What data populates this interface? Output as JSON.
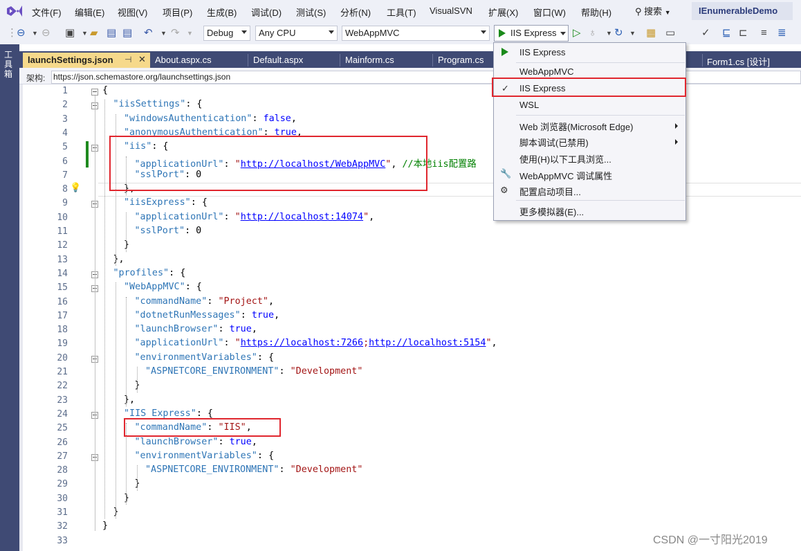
{
  "menubar": {
    "items": [
      "文件(F)",
      "编辑(E)",
      "视图(V)",
      "项目(P)",
      "生成(B)",
      "调试(D)",
      "测试(S)",
      "分析(N)",
      "工具(T)",
      "VisualSVN",
      "扩展(X)",
      "窗口(W)",
      "帮助(H)"
    ],
    "search_label": "搜索",
    "solution_name": "IEnumerableDemo"
  },
  "toolbar": {
    "configuration": "Debug",
    "platform": "Any CPU",
    "startup_project": "WebAppMVC",
    "run_target": "IIS Express"
  },
  "toolbox": {
    "label": "工具箱"
  },
  "tabs": [
    "launchSettings.json",
    "About.aspx.cs",
    "Default.aspx",
    "Mainform.cs",
    "Program.cs",
    "Form1.cs [设计]"
  ],
  "schema": {
    "label": "架构:",
    "value": "https://json.schemastore.org/launchsettings.json"
  },
  "editor": {
    "line_numbers": [
      "1",
      "2",
      "3",
      "4",
      "5",
      "6",
      "7",
      "8",
      "9",
      "10",
      "11",
      "12",
      "13",
      "14",
      "15",
      "16",
      "17",
      "18",
      "19",
      "20",
      "21",
      "22",
      "23",
      "24",
      "25",
      "26",
      "27",
      "28",
      "29",
      "30",
      "31",
      "32",
      "33"
    ],
    "lines": [
      {
        "parts": [
          {
            "t": "{",
            "c": "brace"
          }
        ]
      },
      {
        "parts": [
          {
            "t": "\"iisSettings\"",
            "c": "k"
          },
          {
            "t": ": {",
            "c": "brace"
          }
        ]
      },
      {
        "parts": [
          {
            "t": "\"windowsAuthentication\"",
            "c": "k"
          },
          {
            "t": ": ",
            "c": "brace"
          },
          {
            "t": "false",
            "c": "kw"
          },
          {
            "t": ",",
            "c": "brace"
          }
        ]
      },
      {
        "parts": [
          {
            "t": "\"anonymousAuthentication\"",
            "c": "k"
          },
          {
            "t": ": ",
            "c": "brace"
          },
          {
            "t": "true",
            "c": "kw"
          },
          {
            "t": ",",
            "c": "brace"
          }
        ]
      },
      {
        "parts": [
          {
            "t": "\"iis\"",
            "c": "k"
          },
          {
            "t": ": {",
            "c": "brace"
          }
        ]
      },
      {
        "parts": [
          {
            "t": "\"applicationUrl\"",
            "c": "k"
          },
          {
            "t": ": ",
            "c": "brace"
          },
          {
            "t": "\"",
            "c": "str"
          },
          {
            "t": "http://localhost/WebAppMVC",
            "c": "url"
          },
          {
            "t": "\"",
            "c": "str"
          },
          {
            "t": ", ",
            "c": "brace"
          },
          {
            "t": "//本地iis配置路",
            "c": "comment"
          }
        ]
      },
      {
        "parts": [
          {
            "t": "\"sslPort\"",
            "c": "k"
          },
          {
            "t": ": 0",
            "c": "brace"
          }
        ]
      },
      {
        "parts": [
          {
            "t": "},",
            "c": "brace"
          }
        ]
      },
      {
        "parts": [
          {
            "t": "\"iisExpress\"",
            "c": "k"
          },
          {
            "t": ": {",
            "c": "brace"
          }
        ]
      },
      {
        "parts": [
          {
            "t": "\"applicationUrl\"",
            "c": "k"
          },
          {
            "t": ": ",
            "c": "brace"
          },
          {
            "t": "\"",
            "c": "str"
          },
          {
            "t": "http://localhost:14074",
            "c": "url"
          },
          {
            "t": "\"",
            "c": "str"
          },
          {
            "t": ",",
            "c": "brace"
          }
        ]
      },
      {
        "parts": [
          {
            "t": "\"sslPort\"",
            "c": "k"
          },
          {
            "t": ": 0",
            "c": "brace"
          }
        ]
      },
      {
        "parts": [
          {
            "t": "}",
            "c": "brace"
          }
        ]
      },
      {
        "parts": [
          {
            "t": "},",
            "c": "brace"
          }
        ]
      },
      {
        "parts": [
          {
            "t": "\"profiles\"",
            "c": "k"
          },
          {
            "t": ": {",
            "c": "brace"
          }
        ]
      },
      {
        "parts": [
          {
            "t": "\"WebAppMVC\"",
            "c": "k"
          },
          {
            "t": ": {",
            "c": "brace"
          }
        ]
      },
      {
        "parts": [
          {
            "t": "\"commandName\"",
            "c": "k"
          },
          {
            "t": ": ",
            "c": "brace"
          },
          {
            "t": "\"Project\"",
            "c": "str"
          },
          {
            "t": ",",
            "c": "brace"
          }
        ]
      },
      {
        "parts": [
          {
            "t": "\"dotnetRunMessages\"",
            "c": "k"
          },
          {
            "t": ": ",
            "c": "brace"
          },
          {
            "t": "true",
            "c": "kw"
          },
          {
            "t": ",",
            "c": "brace"
          }
        ]
      },
      {
        "parts": [
          {
            "t": "\"launchBrowser\"",
            "c": "k"
          },
          {
            "t": ": ",
            "c": "brace"
          },
          {
            "t": "true",
            "c": "kw"
          },
          {
            "t": ",",
            "c": "brace"
          }
        ]
      },
      {
        "parts": [
          {
            "t": "\"applicationUrl\"",
            "c": "k"
          },
          {
            "t": ": ",
            "c": "brace"
          },
          {
            "t": "\"",
            "c": "str"
          },
          {
            "t": "https://localhost:7266",
            "c": "url"
          },
          {
            "t": ";",
            "c": "str"
          },
          {
            "t": "http://localhost:5154",
            "c": "url"
          },
          {
            "t": "\"",
            "c": "str"
          },
          {
            "t": ",",
            "c": "brace"
          }
        ]
      },
      {
        "parts": [
          {
            "t": "\"environmentVariables\"",
            "c": "k"
          },
          {
            "t": ": {",
            "c": "brace"
          }
        ]
      },
      {
        "parts": [
          {
            "t": "\"ASPNETCORE_ENVIRONMENT\"",
            "c": "k"
          },
          {
            "t": ": ",
            "c": "brace"
          },
          {
            "t": "\"Development\"",
            "c": "str"
          }
        ]
      },
      {
        "parts": [
          {
            "t": "}",
            "c": "brace"
          }
        ]
      },
      {
        "parts": [
          {
            "t": "},",
            "c": "brace"
          }
        ]
      },
      {
        "parts": [
          {
            "t": "\"IIS Express\"",
            "c": "k"
          },
          {
            "t": ": {",
            "c": "brace"
          }
        ]
      },
      {
        "parts": [
          {
            "t": "\"commandName\"",
            "c": "k"
          },
          {
            "t": ": ",
            "c": "brace"
          },
          {
            "t": "\"IIS\"",
            "c": "str"
          },
          {
            "t": ",",
            "c": "brace"
          }
        ]
      },
      {
        "parts": [
          {
            "t": "\"launchBrowser\"",
            "c": "k"
          },
          {
            "t": ": ",
            "c": "brace"
          },
          {
            "t": "true",
            "c": "kw"
          },
          {
            "t": ",",
            "c": "brace"
          }
        ]
      },
      {
        "parts": [
          {
            "t": "\"environmentVariables\"",
            "c": "k"
          },
          {
            "t": ": {",
            "c": "brace"
          }
        ]
      },
      {
        "parts": [
          {
            "t": "\"ASPNETCORE_ENVIRONMENT\"",
            "c": "k"
          },
          {
            "t": ": ",
            "c": "brace"
          },
          {
            "t": "\"Development\"",
            "c": "str"
          }
        ]
      },
      {
        "parts": [
          {
            "t": "}",
            "c": "brace"
          }
        ]
      },
      {
        "parts": [
          {
            "t": "}",
            "c": "brace"
          }
        ]
      },
      {
        "parts": [
          {
            "t": "}",
            "c": "brace"
          }
        ]
      },
      {
        "parts": [
          {
            "t": "}",
            "c": "brace"
          }
        ]
      },
      {
        "parts": []
      }
    ]
  },
  "run_dropdown": {
    "top_item": "IIS Express",
    "items": [
      "WebAppMVC",
      "IIS Express",
      "WSL",
      "Web 浏览器(Microsoft Edge)",
      "脚本调试(已禁用)",
      "使用(H)以下工具浏览...",
      "WebAppMVC 调试属性",
      "配置启动项目...",
      "更多模拟器(E)..."
    ],
    "checked_item": "IIS Express"
  },
  "watermark": "CSDN @一寸阳光2019",
  "colors": {
    "accent": "#3f4a74",
    "active_tab": "#f6d98b",
    "highlight_box": "#e0262e"
  }
}
